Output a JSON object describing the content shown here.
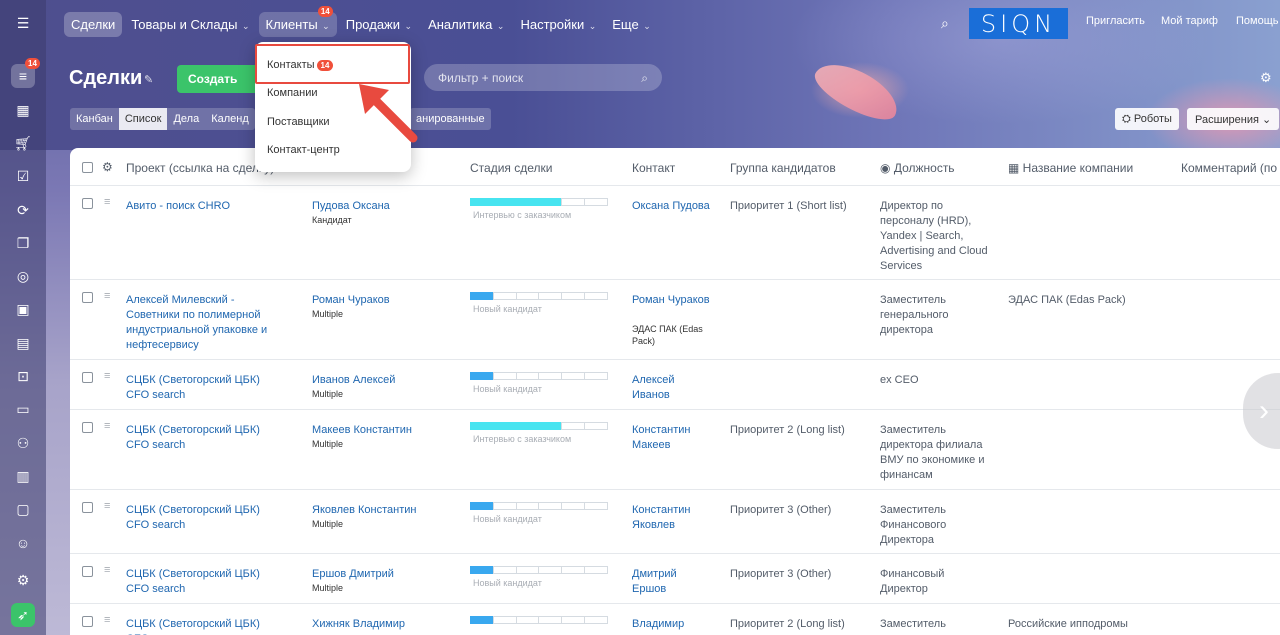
{
  "nav": {
    "items": [
      {
        "label": "Сделки",
        "chevron": false,
        "selected": true
      },
      {
        "label": "Товары и Склады",
        "chevron": true
      },
      {
        "label": "Клиенты",
        "chevron": true,
        "open": true,
        "badge": "14"
      },
      {
        "label": "Продажи",
        "chevron": true
      },
      {
        "label": "Аналитика",
        "chevron": true
      },
      {
        "label": "Настройки",
        "chevron": true
      },
      {
        "label": "Еще",
        "chevron": true
      }
    ],
    "logo": "SIQN",
    "invite": "Пригласить",
    "tariff": "Мой тариф",
    "help": "Помощь"
  },
  "sidebar": {
    "badge": "14"
  },
  "page": {
    "title": "Сделки",
    "create_label": "Создать",
    "filter_placeholder": "Фильтр + поиск"
  },
  "views": {
    "tabs": [
      "Канбан",
      "Список",
      "Дела",
      "Календ"
    ],
    "selected": "Список",
    "planned": "анированные",
    "robots": "Роботы",
    "extensions": "Расширения"
  },
  "dropdown": {
    "items": [
      {
        "label": "Контакты",
        "badge": "14",
        "highlighted": true
      },
      {
        "label": "Компании"
      },
      {
        "label": "Поставщики"
      },
      {
        "label": "Контакт-центр"
      }
    ]
  },
  "table": {
    "columns": {
      "project": "Проект (ссылка на сделку)",
      "stage": "Стадия сделки",
      "contact": "Контакт",
      "group": "Группа кандидатов",
      "position": "Должность",
      "company": "Название компании",
      "comment": "Комментарий (по к"
    },
    "rows": [
      {
        "project": "Авито - поиск CHRO",
        "candidate": "Пудова Оксана",
        "candidate_sub": "Кандидат",
        "stage": "Интервью с заказчиком",
        "stage_progress": 0.67,
        "stage_color": "cyan",
        "contact": "Оксана Пудова",
        "contact_sub": "",
        "group": "Приоритет 1 (Short list)",
        "position": "Директор по персоналу (HRD), Yandex | Search, Advertising and Cloud Services",
        "company": ""
      },
      {
        "project": "Алексей Милевский - Советники по полимерной индустриальной упаковке и нефтесервису",
        "candidate": "Роман Чураков",
        "candidate_sub": "Multiple",
        "stage": "Новый кандидат",
        "stage_progress": 0.17,
        "stage_color": "blue",
        "contact": "Роман Чураков",
        "contact_sub": "ЭДАС ПАК (Edas Pack)",
        "group": "",
        "position": "Заместитель генерального директора",
        "company": "ЭДАС ПАК (Edas Pack)"
      },
      {
        "project": "СЦБК (Светогорский ЦБК) CFO search",
        "candidate": "Иванов Алексей",
        "candidate_sub": "Multiple",
        "stage": "Новый кандидат",
        "stage_progress": 0.17,
        "stage_color": "blue",
        "contact": "Алексей Иванов",
        "contact_sub": "",
        "group": "",
        "position": "ex CEO",
        "company": ""
      },
      {
        "project": "СЦБК (Светогорский ЦБК) CFO search",
        "candidate": "Макеев Константин",
        "candidate_sub": "Multiple",
        "stage": "Интервью с заказчиком",
        "stage_progress": 0.67,
        "stage_color": "cyan",
        "contact": "Константин Макеев",
        "contact_sub": "",
        "group": "Приоритет 2 (Long list)",
        "position": "Заместитель директора филиала ВМУ по экономике и финансам",
        "company": ""
      },
      {
        "project": "СЦБК (Светогорский ЦБК) CFO search",
        "candidate": "Яковлев Константин",
        "candidate_sub": "Multiple",
        "stage": "Новый кандидат",
        "stage_progress": 0.17,
        "stage_color": "blue",
        "contact": "Константин Яковлев",
        "contact_sub": "",
        "group": "Приоритет 3 (Other)",
        "position": "Заместитель Финансового Директора",
        "company": ""
      },
      {
        "project": "СЦБК (Светогорский ЦБК) CFO search",
        "candidate": "Ершов Дмитрий",
        "candidate_sub": "Multiple",
        "stage": "Новый кандидат",
        "stage_progress": 0.17,
        "stage_color": "blue",
        "contact": "Дмитрий Ершов",
        "contact_sub": "",
        "group": "Приоритет 3 (Other)",
        "position": "Финансовый Директор",
        "company": ""
      },
      {
        "project": "СЦБК (Светогорский ЦБК) CFO",
        "candidate": "Хижняк Владимир",
        "candidate_sub": "",
        "stage": "",
        "stage_progress": 0.17,
        "stage_color": "blue",
        "contact": "Владимир",
        "contact_sub": "",
        "group": "Приоритет 2 (Long list)",
        "position": "Заместитель",
        "company": "Российские ипподромы"
      }
    ]
  }
}
